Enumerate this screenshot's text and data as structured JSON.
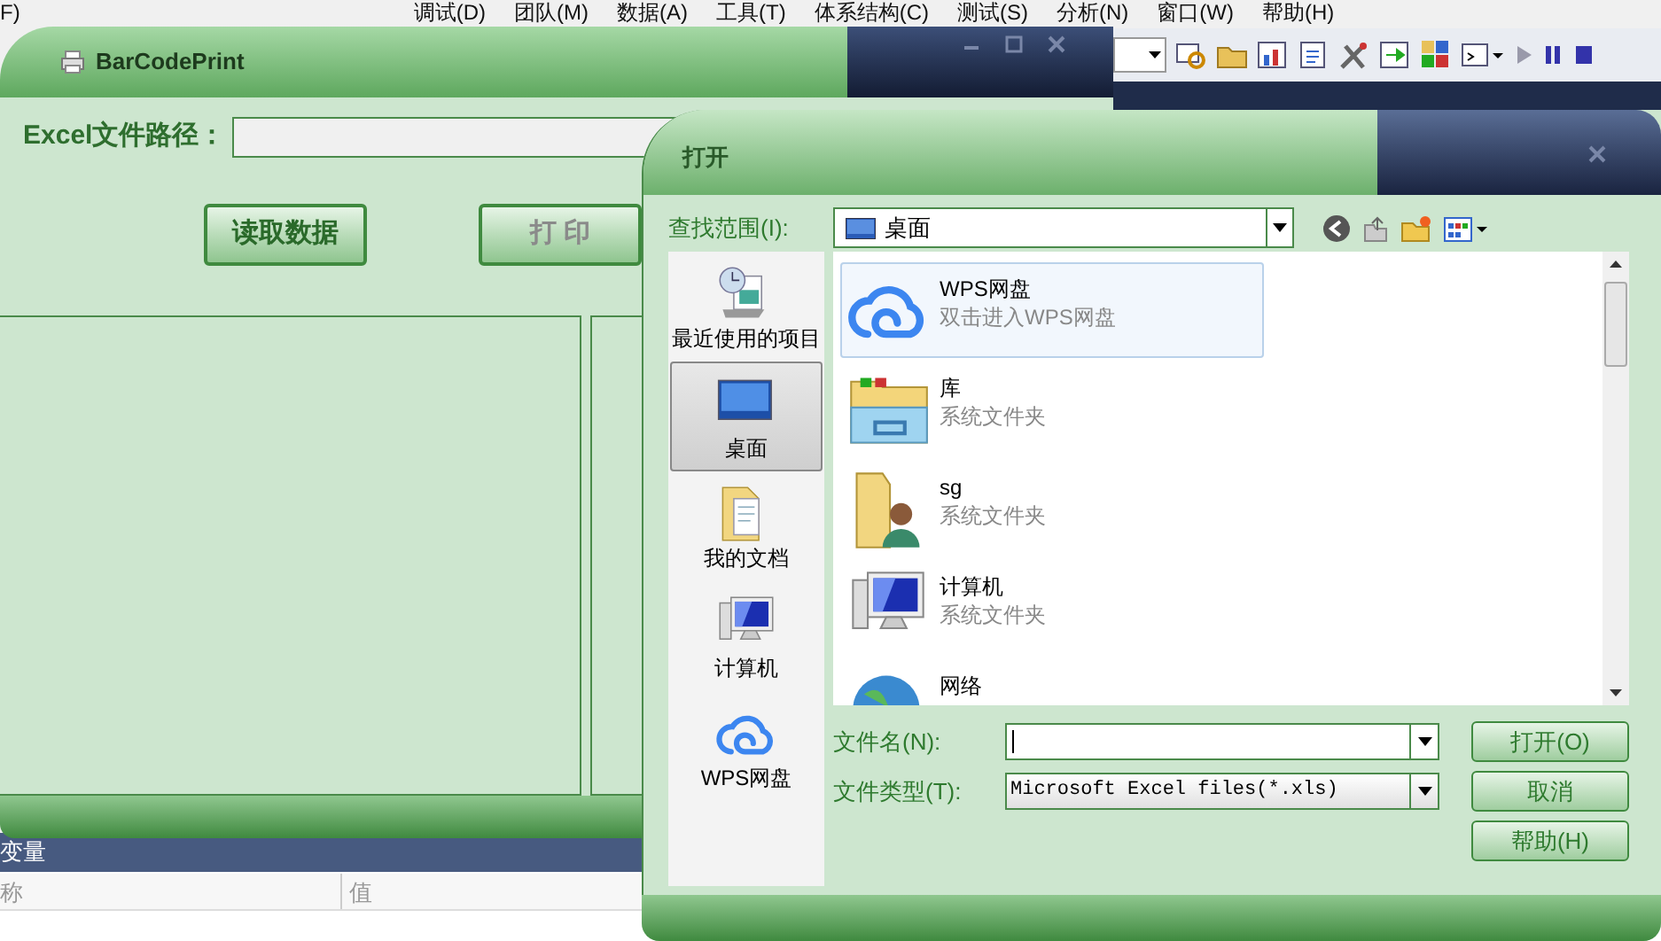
{
  "ide": {
    "menu": [
      "F)",
      "调试(D)",
      "团队(M)",
      "数据(A)",
      "工具(T)",
      "体系结构(C)",
      "测试(S)",
      "分析(N)",
      "窗口(W)",
      "帮助(H)"
    ],
    "variables_panel": {
      "title": "变量",
      "columns": [
        "称",
        "值"
      ]
    }
  },
  "main_window": {
    "title": "BarCodePrint",
    "path_label": "Excel文件路径：",
    "buttons": [
      {
        "label": "读取数据",
        "disabled": false
      },
      {
        "label": "打 印",
        "disabled": true
      }
    ]
  },
  "open_dialog": {
    "title": "打开",
    "look_in_label": "查找范围(I):",
    "look_in_value": "桌面",
    "places": [
      {
        "kind": "recent",
        "label": "最近使用的项目",
        "selected": false
      },
      {
        "kind": "desktop",
        "label": "桌面",
        "selected": true
      },
      {
        "kind": "documents",
        "label": "我的文档",
        "selected": false
      },
      {
        "kind": "computer",
        "label": "计算机",
        "selected": false
      },
      {
        "kind": "cloud",
        "label": "WPS网盘",
        "selected": false
      }
    ],
    "files": [
      {
        "kind": "cloud",
        "name": "WPS网盘",
        "type": "双击进入WPS网盘",
        "selected": true
      },
      {
        "kind": "library",
        "name": "库",
        "type": "系统文件夹",
        "selected": false
      },
      {
        "kind": "user",
        "name": "sg",
        "type": "系统文件夹",
        "selected": false
      },
      {
        "kind": "computer",
        "name": "计算机",
        "type": "系统文件夹",
        "selected": false
      },
      {
        "kind": "network",
        "name": "网络",
        "selected": false
      }
    ],
    "file_name_label": "文件名(N):",
    "file_type_label": "文件类型(T):",
    "file_type_value": "Microsoft Excel files(*.xls)",
    "buttons": [
      "打开(O)",
      "取消",
      "帮助(H)"
    ]
  }
}
